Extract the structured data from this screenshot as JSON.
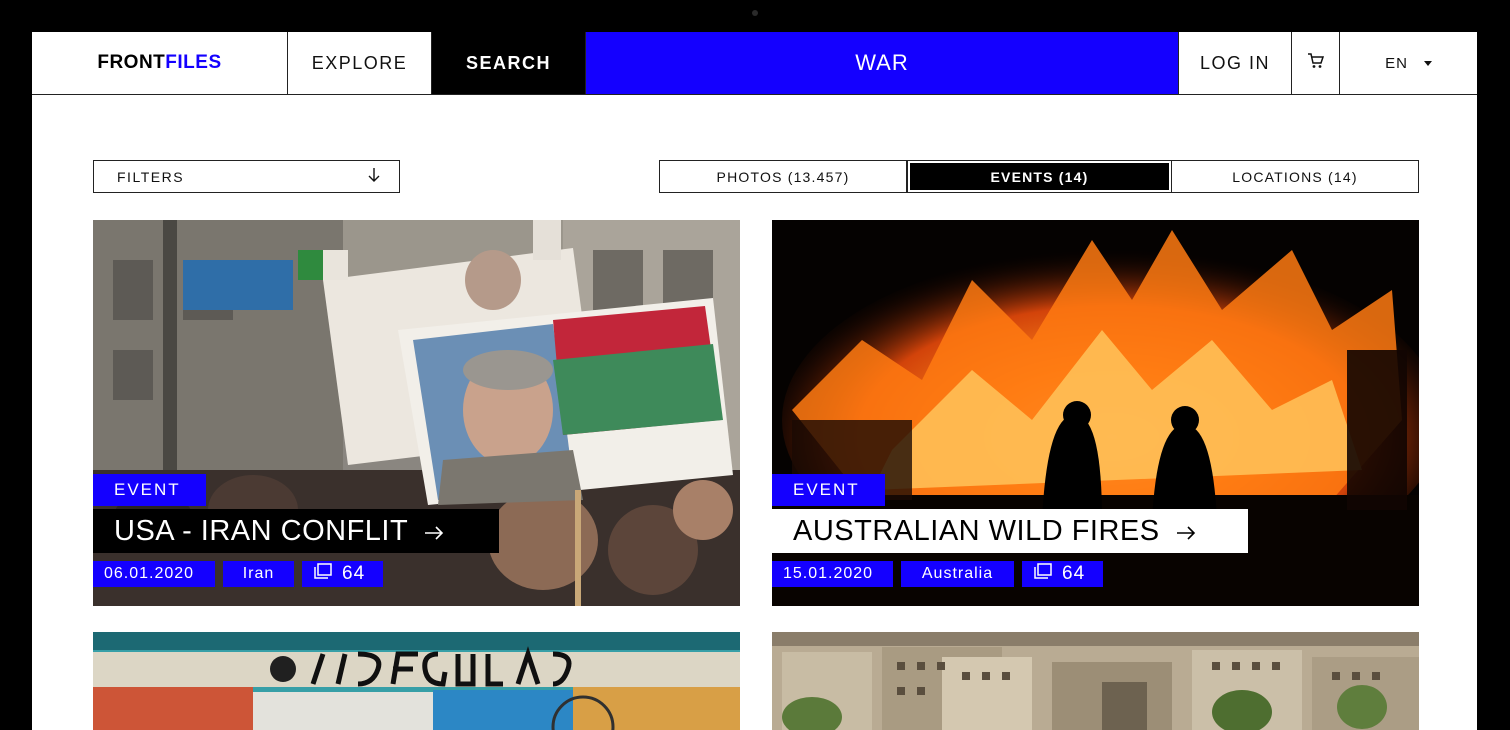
{
  "header": {
    "logo_part1": "FRONT",
    "logo_part2": "FILES",
    "explore": "EXPLORE",
    "search": "SEARCH",
    "query": "WAR",
    "login": "LOG IN",
    "language": "EN"
  },
  "filters": {
    "label": "FILTERS"
  },
  "tabs": [
    {
      "label": "PHOTOS (13.457)"
    },
    {
      "label": "EVENTS (14)"
    },
    {
      "label": "LOCATIONS (14)"
    }
  ],
  "cards": [
    {
      "tag": "EVENT",
      "title": "USA - IRAN CONFLIT",
      "date": "06.01.2020",
      "location": "Iran",
      "count": "64"
    },
    {
      "tag": "EVENT",
      "title": "AUSTRALIAN WILD FIRES",
      "date": "15.01.2020",
      "location": "Australia",
      "count": "64"
    }
  ],
  "colors": {
    "accent": "#1400ff",
    "ink": "#000000"
  }
}
